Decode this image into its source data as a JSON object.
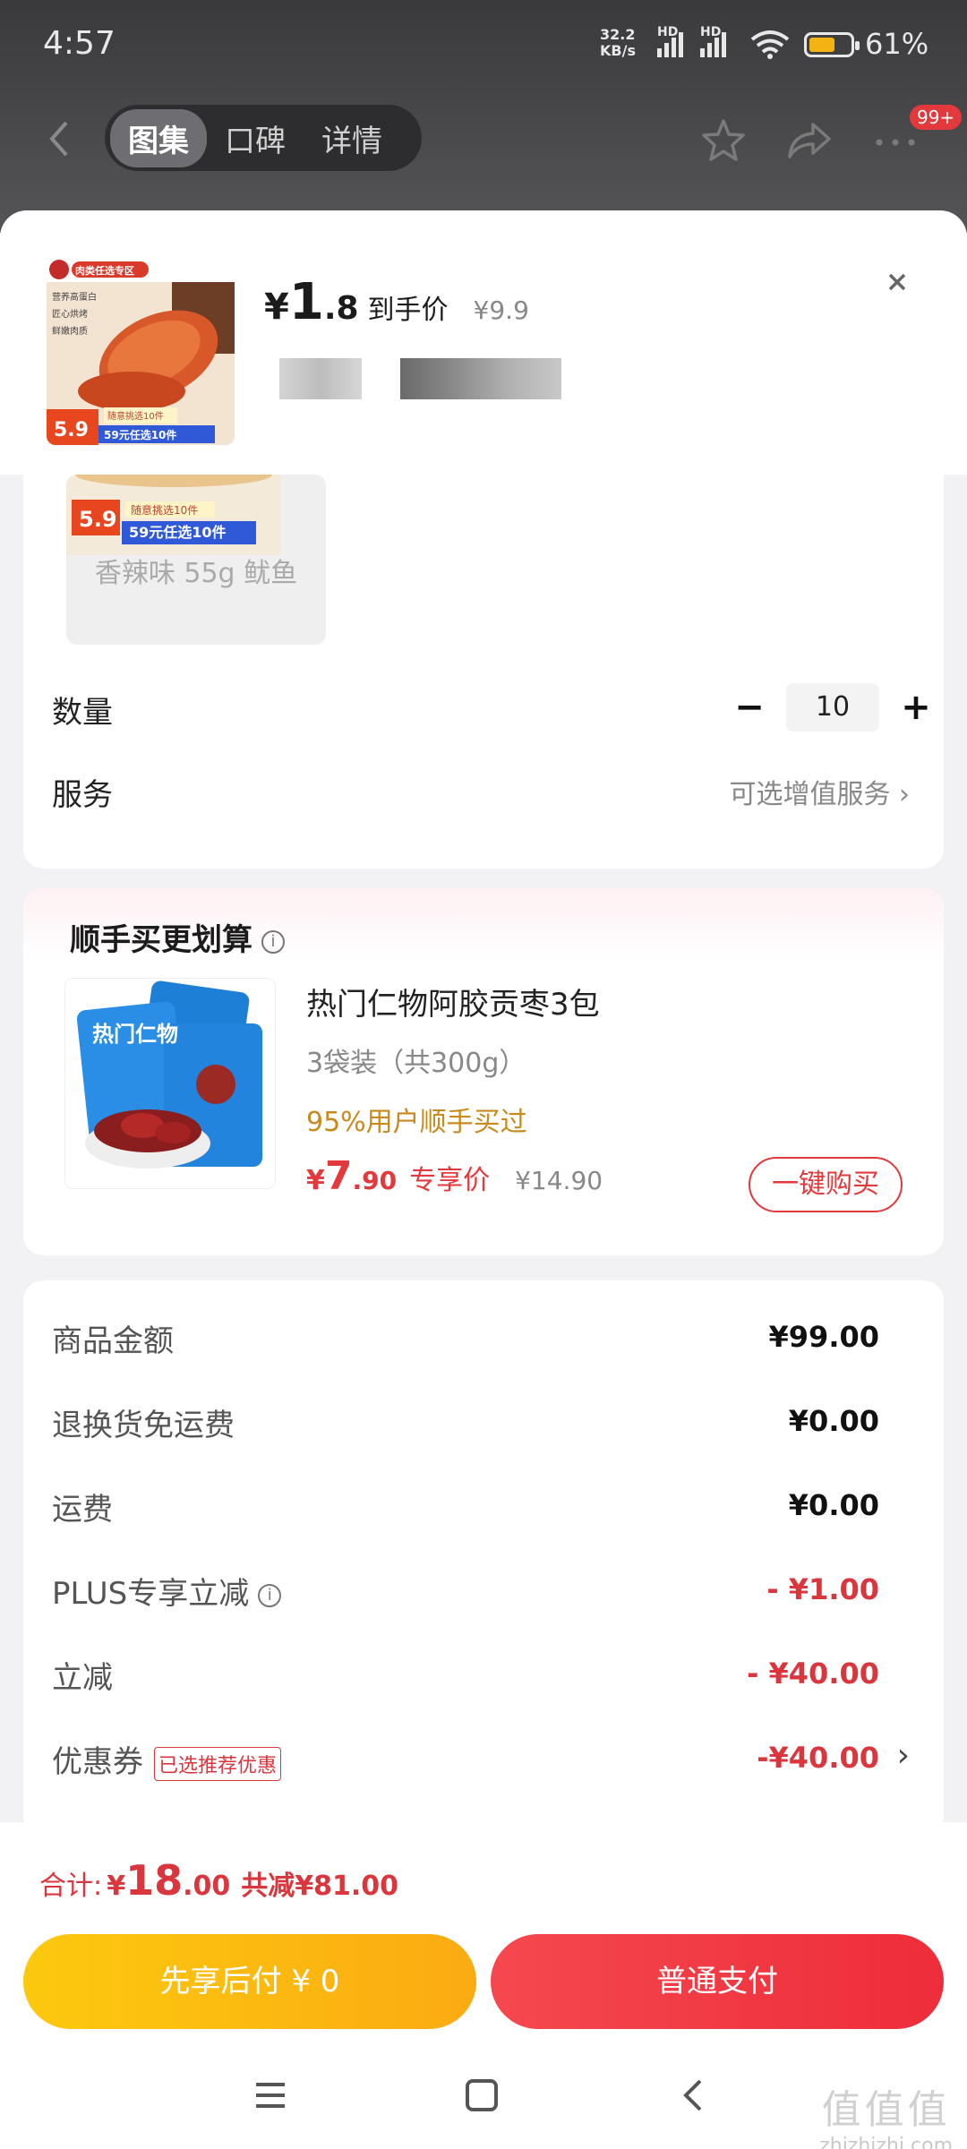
{
  "status": {
    "time": "4:57",
    "net_speed_top": "32.2",
    "net_speed_bottom": "KB/s",
    "hd1": "HD",
    "hd2": "HD",
    "battery": "61%"
  },
  "nav": {
    "tabs": [
      "图集",
      "口碑",
      "详情"
    ],
    "badge": "99+"
  },
  "product": {
    "currency": "¥",
    "price_int": "1",
    "price_dec": ".8",
    "price_tag": "到手价",
    "orig_price": "¥9.9",
    "thumb_banner": "肉类任选专区",
    "thumb_points": [
      "营养高蛋白",
      "匠心烘烤",
      "鲜嫩肉质"
    ],
    "thumb_price": "5.9",
    "thumb_promo_top": "随意挑选10件",
    "thumb_promo": "59元任选10件"
  },
  "spec": {
    "chip_price": "5.9",
    "chip_promo_top": "随意挑选10件",
    "chip_promo": "59元任选10件",
    "chip_label": "香辣味 55g 鱿鱼"
  },
  "quantity": {
    "label": "数量",
    "value": "10",
    "minus": "−",
    "plus": "+"
  },
  "service": {
    "label": "服务",
    "value": "可选增值服务 ›"
  },
  "addon": {
    "title": "顺手买更划算",
    "name": "热门仁物阿胶贡枣3包",
    "pack": "3袋装（共300g）",
    "bought": "95%用户顺手买过",
    "price_yen": "¥",
    "price_int": "7",
    "price_dec": ".90",
    "price_tag": "专享价",
    "orig_price": "¥14.90",
    "buy_label": "一键购买",
    "bag_text": "热门仁物"
  },
  "summary": {
    "rows": [
      {
        "label": "商品金额",
        "value": "¥99.00"
      },
      {
        "label": "退换货免运费",
        "value": "¥0.00"
      },
      {
        "label": "运费",
        "value": "¥0.00"
      },
      {
        "label": "PLUS专享立减",
        "value": "- ¥1.00"
      },
      {
        "label": "立减",
        "value": "- ¥40.00"
      },
      {
        "label": "优惠券",
        "value": "-¥40.00",
        "tag": "已选推荐优惠"
      }
    ]
  },
  "footer": {
    "total_label": "合计:",
    "total_yen": "¥",
    "total_int": "18",
    "total_dec": ".00",
    "reduce": "共减¥81.00",
    "pay_later": "先享后付 ¥ 0",
    "pay_normal": "普通支付"
  },
  "watermark": {
    "big": "值值值",
    "small": "zhizhizhi.com"
  },
  "colors": {
    "accent_red": "#e4393c",
    "yellow": "#fcc90e"
  }
}
